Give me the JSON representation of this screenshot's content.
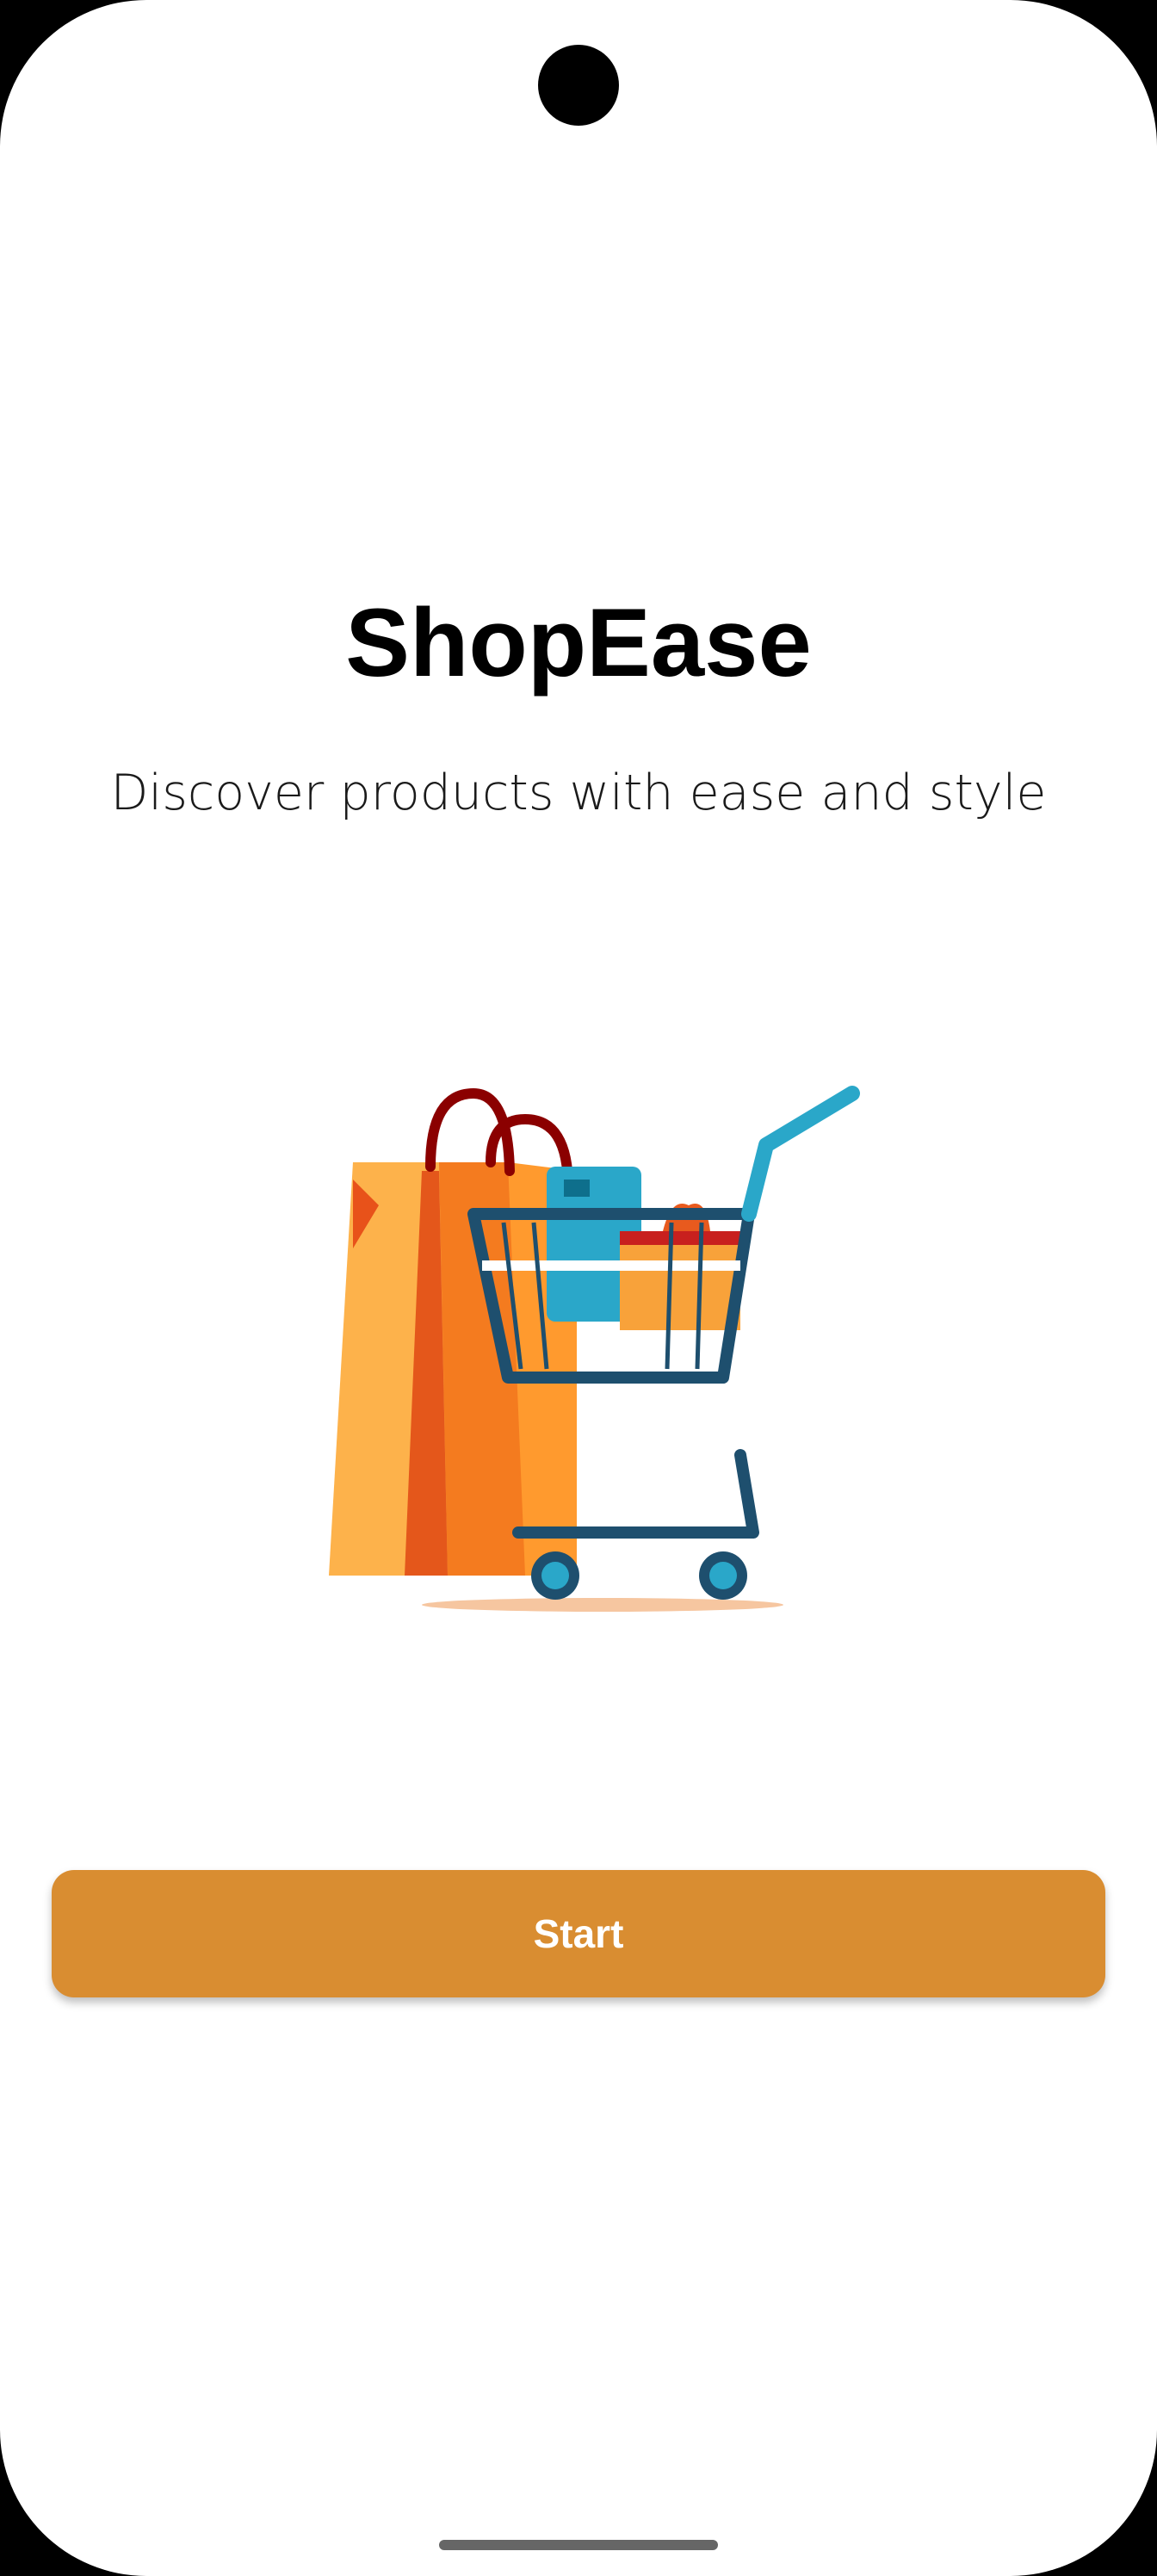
{
  "app": {
    "title": "ShopEase",
    "tagline": "Discover products with ease and style"
  },
  "hero_image": {
    "icon": "shopping-bag-and-cart-illustration"
  },
  "actions": {
    "start_label": "Start"
  },
  "colors": {
    "primary": "#D98D31",
    "background": "#FFFFFF",
    "text": "#000000"
  }
}
